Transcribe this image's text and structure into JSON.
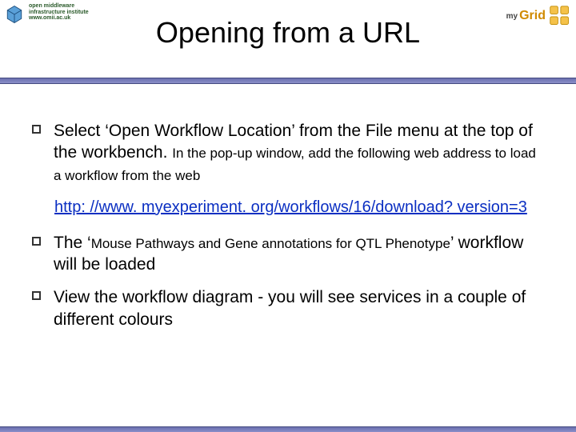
{
  "logos": {
    "left": {
      "line1": "open middleware",
      "line2": "infrastructure institute",
      "line3": "www.omii.ac.uk"
    },
    "right": {
      "prefix": "my",
      "main": "Grid"
    }
  },
  "title": "Opening from a URL",
  "bullets": [
    {
      "main": "Select ‘Open Workflow Location’ from the File menu at the top of the workbench. ",
      "tail_small": "In the pop-up window, add the following web address to load a workflow from the web"
    },
    {
      "main_pre": "The ‘",
      "main_mid_small": "Mouse Pathways and Gene annotations for QTL Phenotype",
      "main_post": "’ workflow will be loaded"
    },
    {
      "main": "View the workflow diagram - you will see services in a couple of different colours"
    }
  ],
  "link": "http: //www. myexperiment. org/workflows/16/download? version=3"
}
